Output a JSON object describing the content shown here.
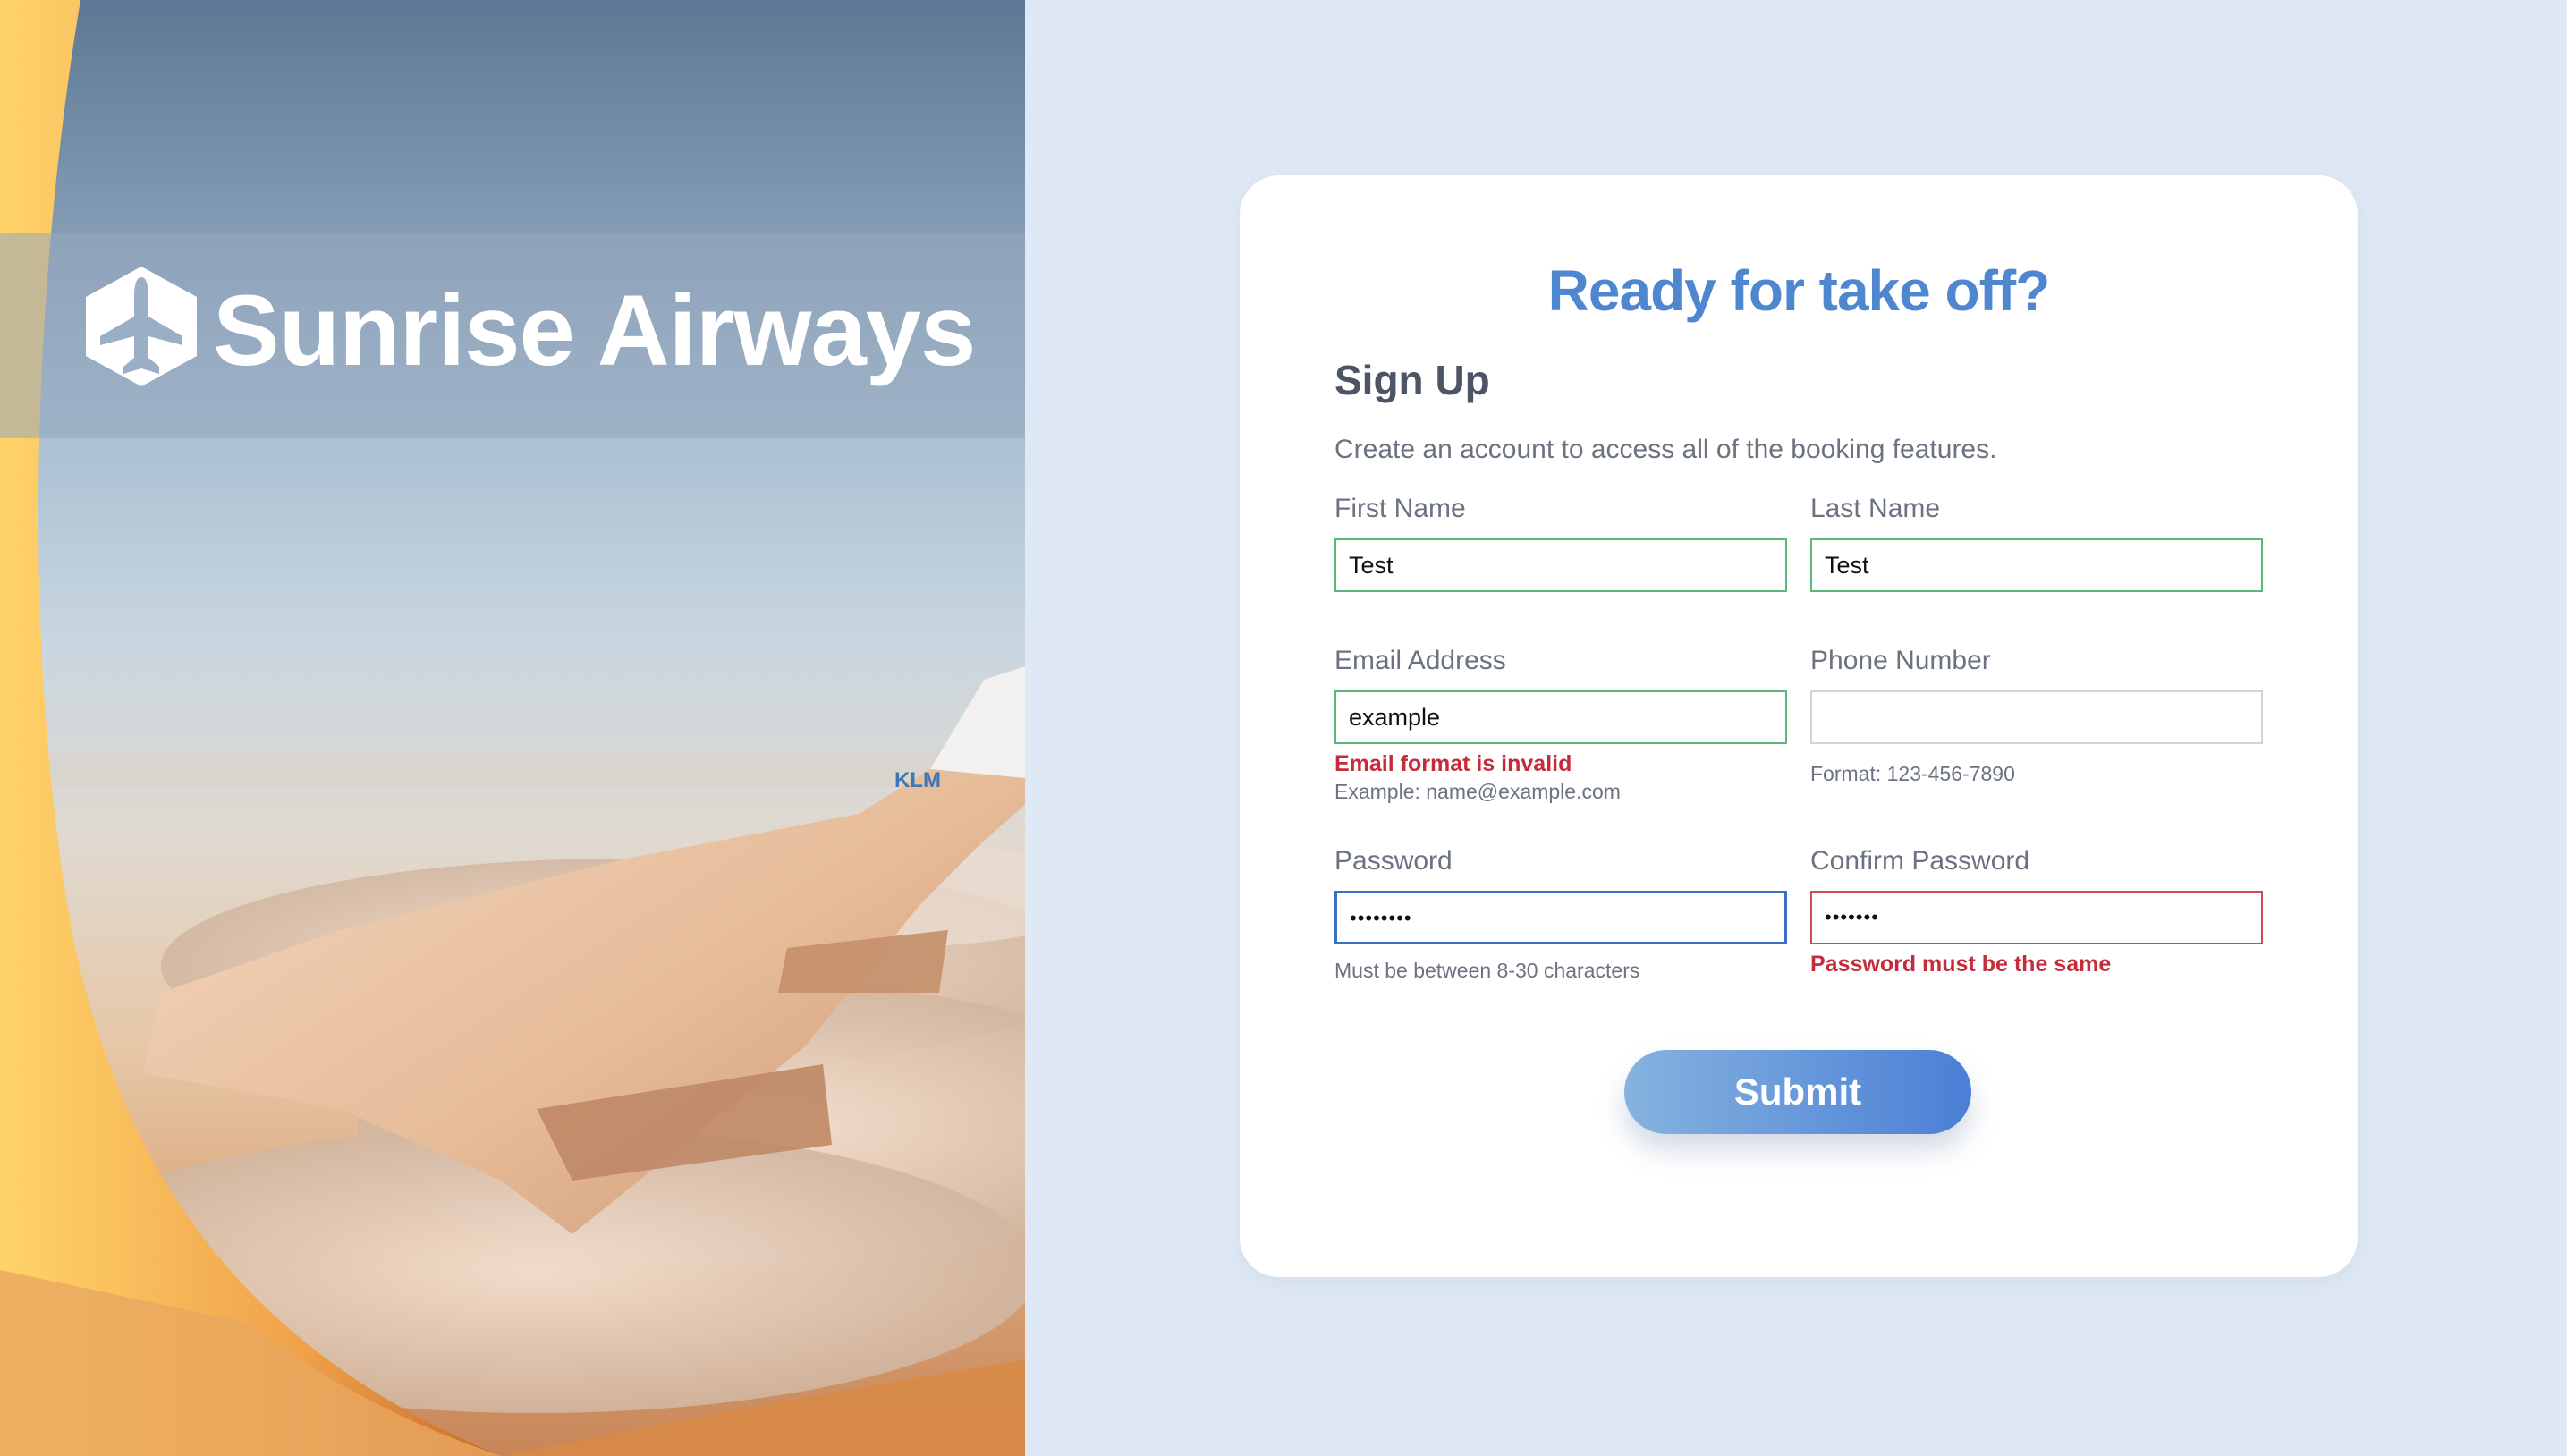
{
  "brand": {
    "name": "Sunrise Airways",
    "wing_text": "KLM"
  },
  "form": {
    "headline": "Ready for take off?",
    "title": "Sign Up",
    "description": "Create an account to access all of the booking features.",
    "first_name": {
      "label": "First Name",
      "value": "Test"
    },
    "last_name": {
      "label": "Last Name",
      "value": "Test"
    },
    "email": {
      "label": "Email Address",
      "value": "example",
      "error": "Email format is invalid",
      "hint": "Example: name@example.com"
    },
    "phone": {
      "label": "Phone Number",
      "value": "",
      "hint": "Format: 123-456-7890"
    },
    "password": {
      "label": "Password",
      "value": "••••••••",
      "hint": "Must be between 8-30 characters"
    },
    "confirm_password": {
      "label": "Confirm Password",
      "value": "•••••••",
      "error": "Password must be the same"
    },
    "submit_label": "Submit"
  },
  "colors": {
    "page_bg": "#dfe9f5",
    "accent": "#4e86cf",
    "valid_border": "#5cb87a",
    "focus_border": "#3d6cc7",
    "error": "#c52b3b"
  }
}
